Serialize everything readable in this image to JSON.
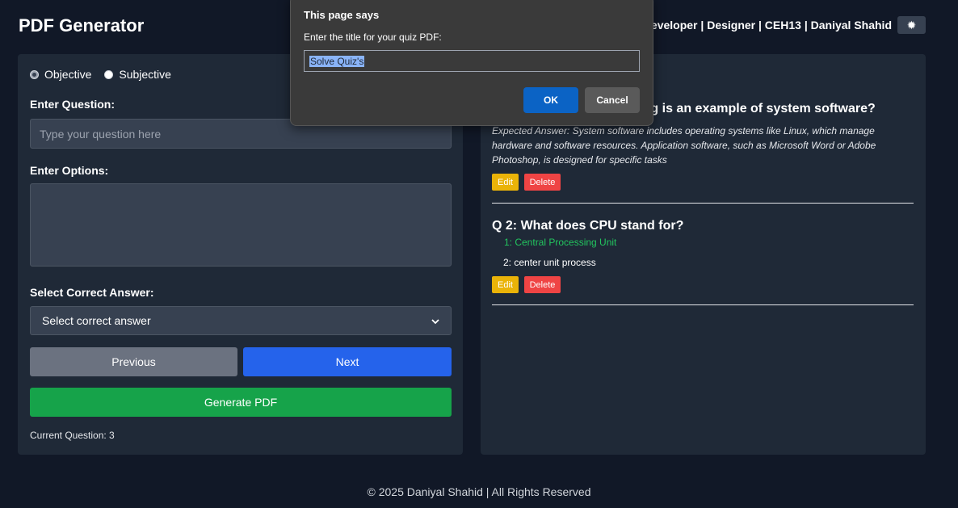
{
  "header": {
    "title": "PDF Generator",
    "credits": "Developer | Designer | CEH13 | Daniyal Shahid",
    "theme_icon": "gear-icon"
  },
  "form": {
    "type_options": [
      "Objective",
      "Subjective"
    ],
    "selected_type": "Objective",
    "question_label": "Enter Question:",
    "question_placeholder": "Type your question here",
    "options_label": "Enter Options:",
    "answer_label": "Select Correct Answer:",
    "answer_selected": "Select correct answer",
    "previous_label": "Previous",
    "next_label": "Next",
    "generate_label": "Generate PDF",
    "current_question": "Current Question: 3"
  },
  "questions": [
    {
      "title": "Q 1: Which of the following is an example of system software?",
      "expected_answer": "Expected Answer: System software includes operating systems like Linux, which manage hardware and software resources. Application software, such as Microsoft Word or Adobe Photoshop, is designed for specific tasks",
      "edit_label": "Edit",
      "delete_label": "Delete"
    },
    {
      "title": "Q 2: What does CPU stand for?",
      "options": [
        "1: Central Processing Unit",
        "2: center unit process"
      ],
      "correct_index": 0,
      "edit_label": "Edit",
      "delete_label": "Delete"
    }
  ],
  "footer": "© 2025 Daniyal Shahid | All Rights Reserved",
  "dialog": {
    "title": "This page says",
    "message": "Enter the title for your quiz PDF:",
    "value": "Solve Quiz's",
    "ok_label": "OK",
    "cancel_label": "Cancel"
  },
  "colors": {
    "background": "#111827",
    "panel": "#1f2937",
    "next": "#2563eb",
    "generate": "#16a34a",
    "edit": "#eab308",
    "delete": "#ef4444",
    "correct_option": "#22c55e"
  }
}
